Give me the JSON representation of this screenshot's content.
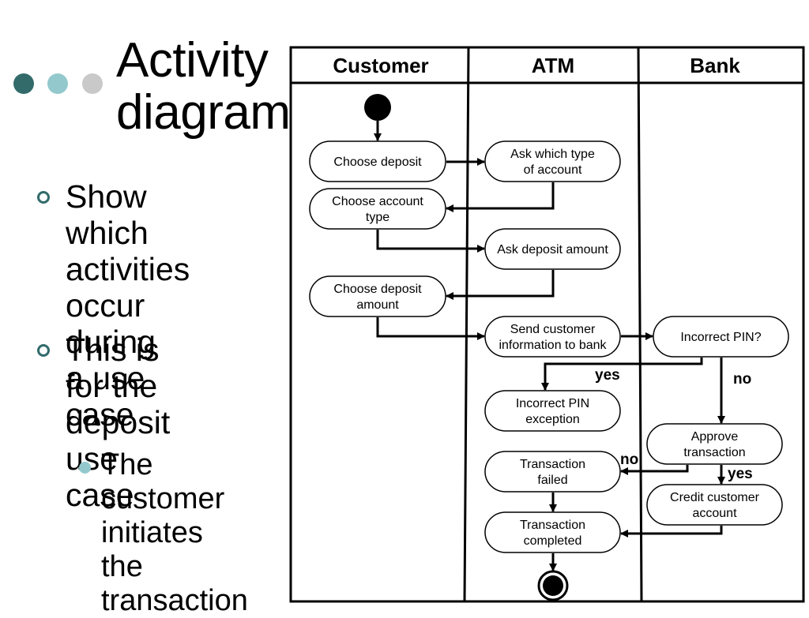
{
  "slide": {
    "title": "Activity\ndiagram",
    "decor_dot_colors": [
      "#336b6b",
      "#93c9cc",
      "#c9c9c9"
    ],
    "bullets": [
      {
        "level": 1,
        "text": "Show which\nactivities\noccur during\na use case"
      },
      {
        "level": 1,
        "text": "This is for the\ndeposit use\ncase"
      },
      {
        "level": 2,
        "text": "The\ncustomer\ninitiates the\ntransaction"
      }
    ]
  },
  "diagram": {
    "type": "uml-activity-swimlane",
    "lanes": [
      "Customer",
      "ATM",
      "Bank"
    ],
    "start": {
      "lane": "Customer"
    },
    "end": {
      "lane": "ATM"
    },
    "nodes": [
      {
        "id": "choose_deposit",
        "lane": "Customer",
        "lines": [
          "Choose deposit"
        ]
      },
      {
        "id": "ask_account_type",
        "lane": "ATM",
        "lines": [
          "Ask which type",
          "of account"
        ]
      },
      {
        "id": "choose_account_type",
        "lane": "Customer",
        "lines": [
          "Choose account",
          "type"
        ]
      },
      {
        "id": "ask_deposit_amount",
        "lane": "ATM",
        "lines": [
          "Ask deposit amount"
        ]
      },
      {
        "id": "choose_deposit_amount",
        "lane": "Customer",
        "lines": [
          "Choose deposit",
          "amount"
        ]
      },
      {
        "id": "send_info",
        "lane": "ATM",
        "lines": [
          "Send customer",
          "information to bank"
        ]
      },
      {
        "id": "incorrect_pin_q",
        "lane": "Bank",
        "lines": [
          "Incorrect PIN?"
        ]
      },
      {
        "id": "incorrect_pin_exc",
        "lane": "ATM",
        "lines": [
          "Incorrect PIN",
          "exception"
        ]
      },
      {
        "id": "approve",
        "lane": "Bank",
        "lines": [
          "Approve",
          "transaction"
        ]
      },
      {
        "id": "failed",
        "lane": "ATM",
        "lines": [
          "Transaction",
          "failed"
        ]
      },
      {
        "id": "credit",
        "lane": "Bank",
        "lines": [
          "Credit customer",
          "account"
        ]
      },
      {
        "id": "completed",
        "lane": "ATM",
        "lines": [
          "Transaction",
          "completed"
        ]
      }
    ],
    "edges": [
      {
        "from": "start",
        "to": "choose_deposit"
      },
      {
        "from": "choose_deposit",
        "to": "ask_account_type"
      },
      {
        "from": "ask_account_type",
        "to": "choose_account_type"
      },
      {
        "from": "choose_account_type",
        "to": "ask_deposit_amount"
      },
      {
        "from": "ask_deposit_amount",
        "to": "choose_deposit_amount"
      },
      {
        "from": "choose_deposit_amount",
        "to": "send_info"
      },
      {
        "from": "send_info",
        "to": "incorrect_pin_q"
      },
      {
        "from": "incorrect_pin_q",
        "to": "incorrect_pin_exc",
        "guard": "yes"
      },
      {
        "from": "incorrect_pin_q",
        "to": "approve",
        "guard": "no"
      },
      {
        "from": "approve",
        "to": "failed",
        "guard": "no"
      },
      {
        "from": "approve",
        "to": "credit",
        "guard": "yes"
      },
      {
        "from": "failed",
        "to": "completed"
      },
      {
        "from": "credit",
        "to": "completed"
      },
      {
        "from": "completed",
        "to": "end"
      }
    ]
  }
}
